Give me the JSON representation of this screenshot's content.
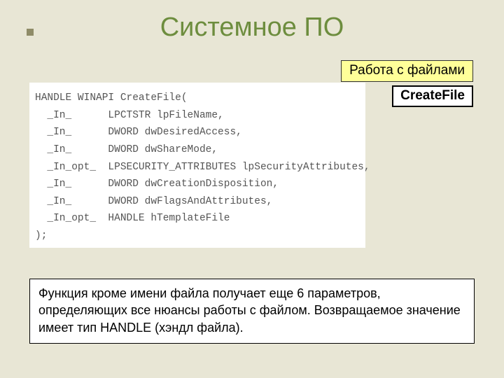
{
  "title": "Системное ПО",
  "subtitle": "Работа с файлами",
  "function_name": "CreateFile",
  "code": "HANDLE WINAPI CreateFile(\n  _In_      LPCTSTR lpFileName,\n  _In_      DWORD dwDesiredAccess,\n  _In_      DWORD dwShareMode,\n  _In_opt_  LPSECURITY_ATTRIBUTES lpSecurityAttributes,\n  _In_      DWORD dwCreationDisposition,\n  _In_      DWORD dwFlagsAndAttributes,\n  _In_opt_  HANDLE hTemplateFile\n);",
  "description": "Функция кроме имени файла получает еще 6 параметров, определяющих все нюансы работы с файлом. Возвращаемое значение имеет тип HANDLE (хэндл файла)."
}
